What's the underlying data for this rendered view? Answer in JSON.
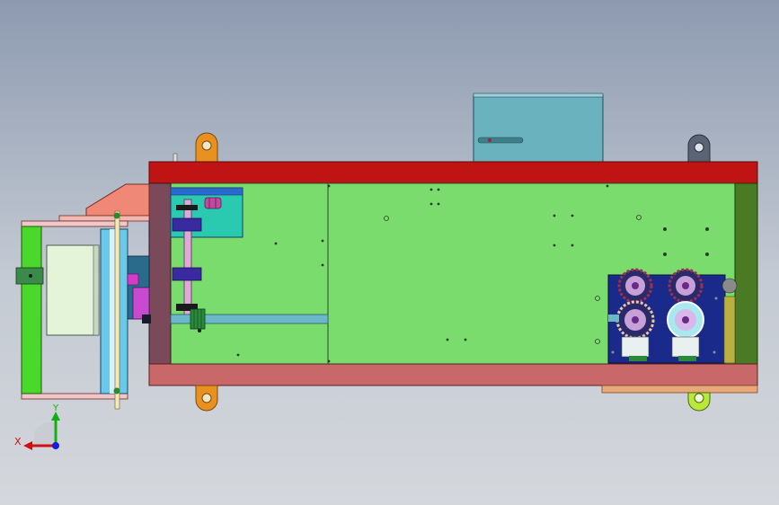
{
  "viewport": {
    "background_top": "#8d9ab0",
    "background_bottom": "#d4d7dc"
  },
  "triad": {
    "x_label": "X",
    "y_label": "Y",
    "x_color": "#d01010",
    "y_color": "#10b010",
    "z_color": "#1a1ae0"
  },
  "colors": {
    "frame_top": "#c01414",
    "frame_bottom": "#c86868",
    "base_plate": "#7adc6c",
    "end_post_left": "#7a4a5a",
    "end_post_right": "#4a7a24",
    "lift_lugs": "#e89020",
    "motor_box": "#6ab2be",
    "roller": "#6ac8e8",
    "gear_assembly": "#1a2a8a"
  },
  "icons": [
    "triad-icon"
  ]
}
